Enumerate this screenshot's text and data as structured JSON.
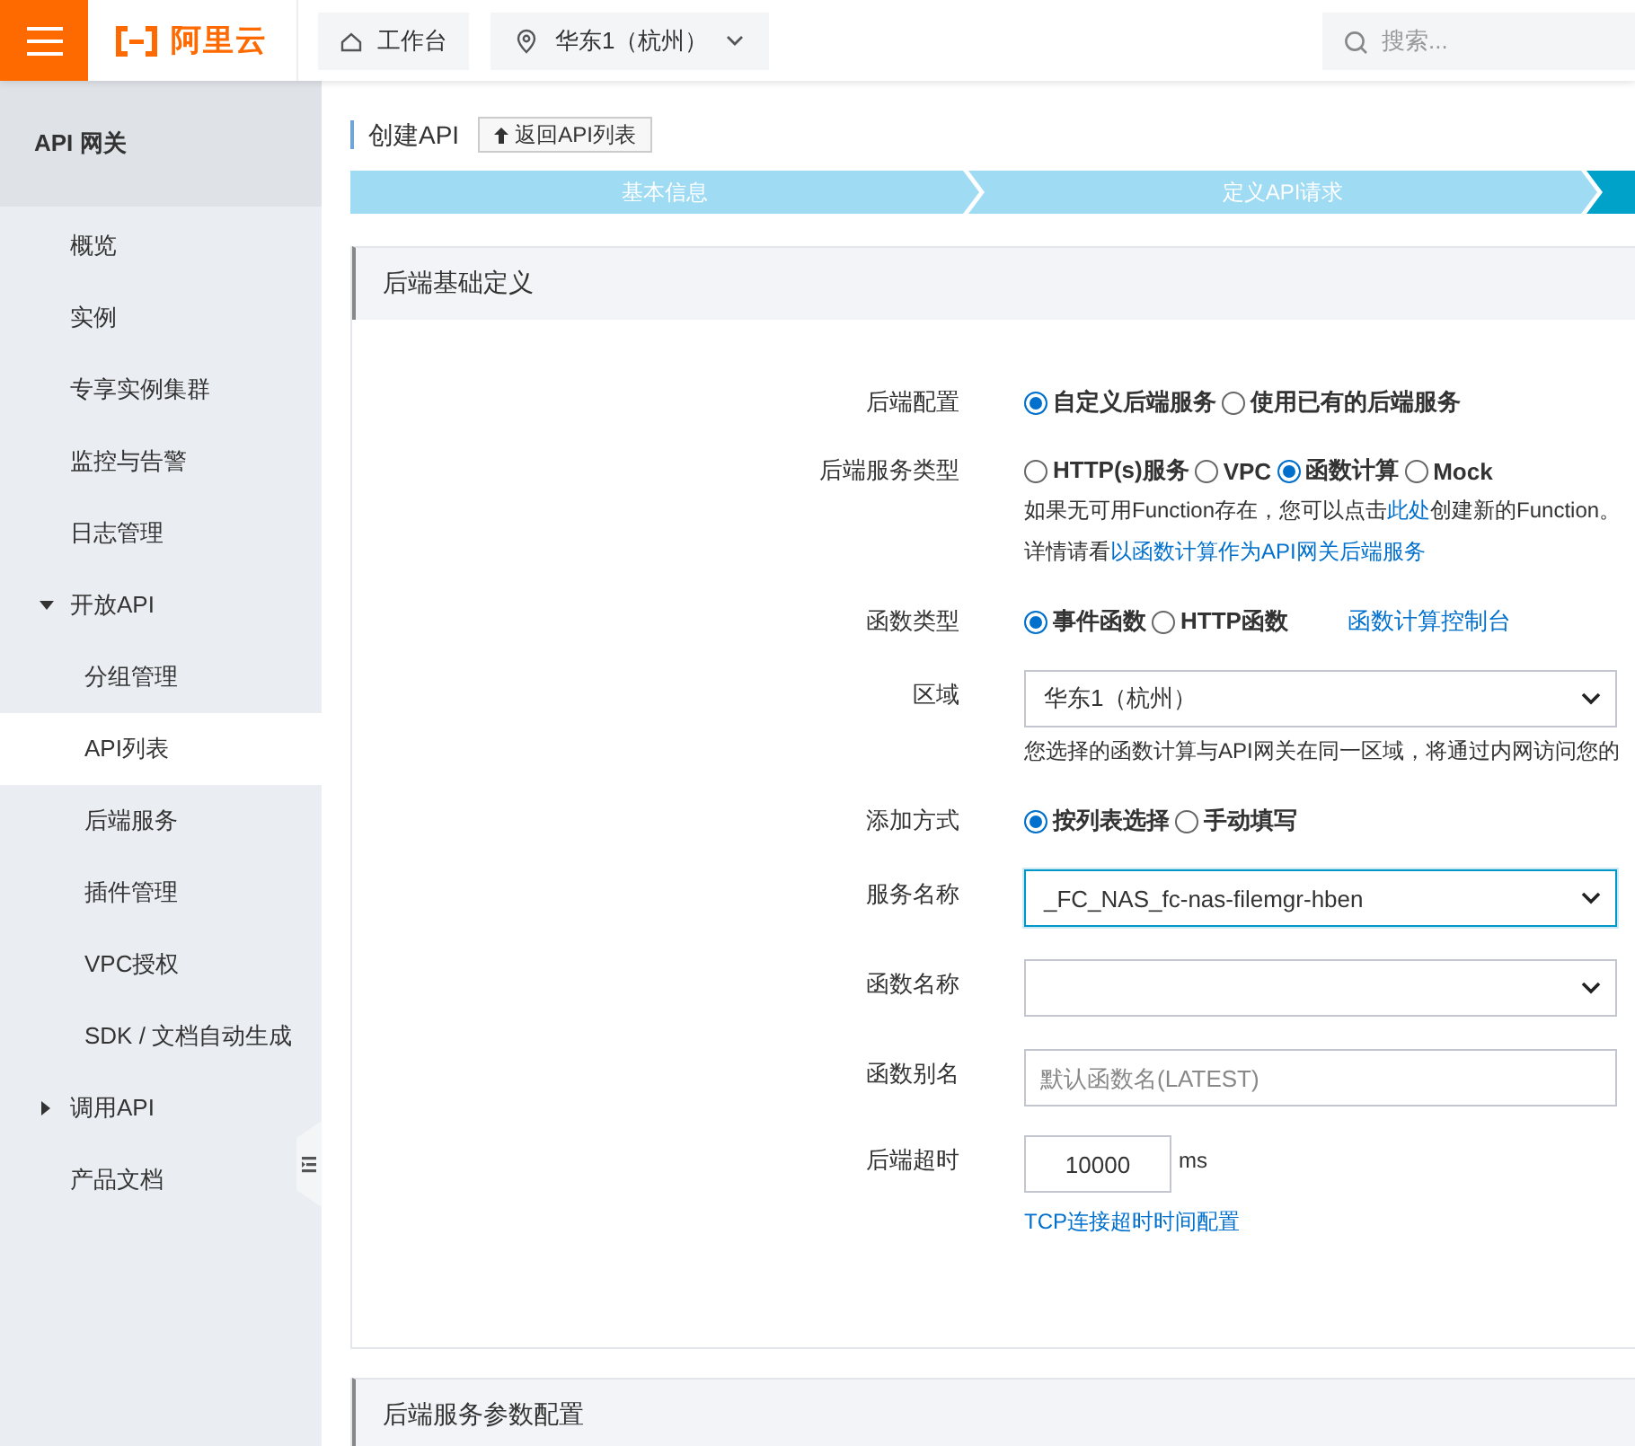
{
  "topbar": {
    "logo": "阿里云",
    "workbench": "工作台",
    "region": "华东1（杭州）",
    "search": {
      "placeholder": "搜索..."
    }
  },
  "sidebar": {
    "title": "API 网关",
    "items": [
      {
        "label": "概览",
        "selected": false
      },
      {
        "label": "实例",
        "selected": false
      },
      {
        "label": "专享实例集群",
        "selected": false
      },
      {
        "label": "监控与告警",
        "selected": false
      },
      {
        "label": "日志管理",
        "selected": false
      },
      {
        "label": "开放API",
        "selected": false,
        "expanded": true,
        "children": [
          {
            "label": "分组管理",
            "selected": false
          },
          {
            "label": "API列表",
            "selected": true
          },
          {
            "label": "后端服务",
            "selected": false
          },
          {
            "label": "插件管理",
            "selected": false
          },
          {
            "label": "VPC授权",
            "selected": false
          },
          {
            "label": "SDK / 文档自动生成",
            "selected": false
          }
        ]
      },
      {
        "label": "调用API",
        "selected": false,
        "expanded": false
      },
      {
        "label": "产品文档",
        "selected": false
      }
    ]
  },
  "breadcrumb": {
    "title": "创建API",
    "back_button": "返回API列表"
  },
  "steps": [
    {
      "label": "基本信息",
      "selected": false
    },
    {
      "label": "定义API请求",
      "selected": false
    },
    {
      "selected": true
    }
  ],
  "sections": [
    {
      "title": "后端基础定义",
      "rows": [
        {
          "label": "后端配置",
          "kind": "radio",
          "options": [
            {
              "label": "自定义后端服务",
              "selected": true
            },
            {
              "label": "使用已有的后端服务",
              "selected": false
            }
          ]
        },
        {
          "label": "后端服务类型",
          "kind": "radio",
          "options": [
            {
              "label": "HTTP(s)服务",
              "selected": false
            },
            {
              "label": "VPC",
              "selected": false
            },
            {
              "label": "函数计算",
              "selected": true
            },
            {
              "label": "Mock",
              "selected": false
            }
          ],
          "notes": [
            [
              {
                "text": "如果无可用Function存在，您可以点击"
              },
              {
                "text": "此处",
                "link": true
              },
              {
                "text": "创建新的Function。"
              }
            ],
            [
              {
                "text": "详情请看"
              },
              {
                "text": "以函数计算作为API网关后端服务",
                "link": true
              }
            ]
          ]
        },
        {
          "label": "函数类型",
          "kind": "radio",
          "options": [
            {
              "label": "事件函数",
              "selected": true
            },
            {
              "label": "HTTP函数",
              "selected": false
            }
          ],
          "link": "函数计算控制台"
        },
        {
          "label": "区域",
          "kind": "select",
          "value": "华东1（杭州）",
          "notes": [
            [
              {
                "text": "您选择的函数计算与API网关在同一区域，将通过内网访问您的"
              }
            ]
          ]
        },
        {
          "label": "添加方式",
          "kind": "radio",
          "options": [
            {
              "label": "按列表选择",
              "selected": true
            },
            {
              "label": "手动填写",
              "selected": false
            }
          ]
        },
        {
          "label": "服务名称",
          "kind": "select",
          "value": "_FC_NAS_fc-nas-filemgr-hben",
          "focused": true
        },
        {
          "label": "函数名称",
          "kind": "select"
        },
        {
          "label": "函数别名",
          "kind": "input",
          "placeholder": "默认函数名(LATEST)"
        },
        {
          "label": "后端超时",
          "kind": "number",
          "value": "10000",
          "unit": "ms",
          "link": "TCP连接超时时间配置"
        }
      ]
    },
    {
      "title": "后端服务参数配置"
    }
  ]
}
